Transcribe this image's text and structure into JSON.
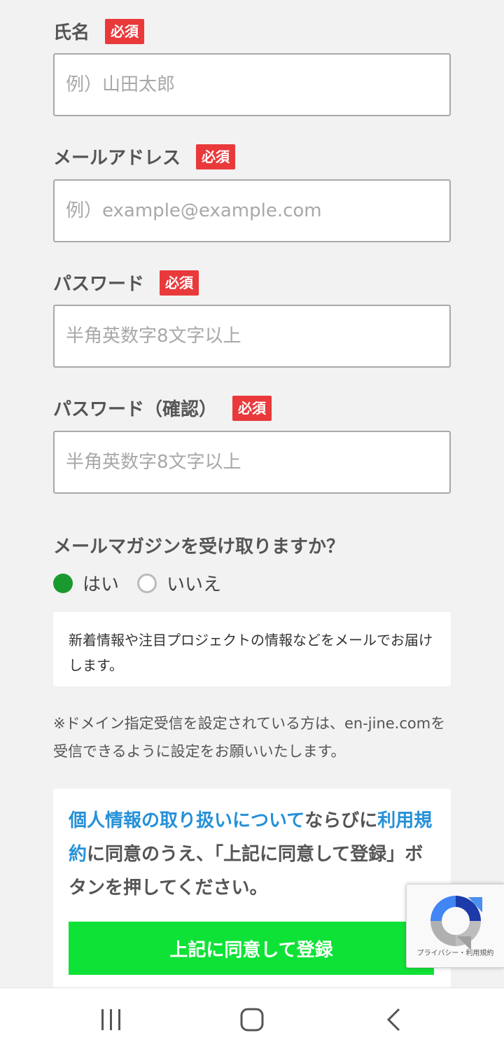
{
  "form": {
    "name": {
      "label": "氏名",
      "badge": "必須",
      "placeholder": "例）山田太郎"
    },
    "email": {
      "label": "メールアドレス",
      "badge": "必須",
      "placeholder": "例）example@example.com"
    },
    "password": {
      "label": "パスワード",
      "badge": "必須",
      "placeholder": "半角英数字8文字以上"
    },
    "password_confirm": {
      "label": "パスワード（確認）",
      "badge": "必須",
      "placeholder": "半角英数字8文字以上"
    }
  },
  "newsletter": {
    "question": "メールマガジンを受け取りますか？",
    "options": [
      {
        "label": "はい",
        "selected": true
      },
      {
        "label": "いいえ",
        "selected": false
      }
    ],
    "note": "新着情報や注目プロジェクトの情報などをメールでお届けします。",
    "selected_color": "#1a9a2e"
  },
  "domain_note": "※ドメイン指定受信を設定されている方は、en-jine.comを受信できるように設定をお願いいたします。",
  "agreement": {
    "privacy_link": "個人情報の取り扱いについて",
    "text_1": "ならびに",
    "terms_link": "利用規約",
    "text_2": "に同意のうえ、「上記に同意して登録」ボタンを押してください。",
    "submit_label": "上記に同意して登録",
    "link_color": "#2590d8",
    "button_color": "#0fe236"
  },
  "recaptcha": {
    "links": "プライバシー・利用規約"
  },
  "navbar": {
    "icons": [
      "recent-apps-icon",
      "home-icon",
      "back-icon"
    ]
  },
  "colors": {
    "badge": "#e9393b",
    "background": "#f2f2f2"
  }
}
